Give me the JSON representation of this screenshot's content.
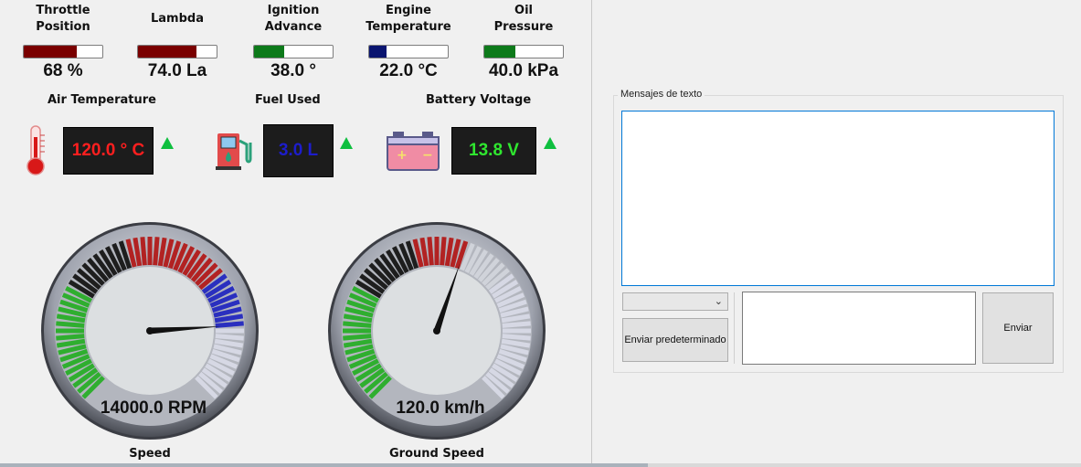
{
  "top_gauges": [
    {
      "label_line1": "Throttle",
      "label_line2": "Position",
      "value": "68 %",
      "fill": 0.68,
      "color": "#7a0000"
    },
    {
      "label_line1": "Lambda",
      "label_line2": "",
      "value": "74.0 La",
      "fill": 0.74,
      "color": "#7a0000"
    },
    {
      "label_line1": "Ignition",
      "label_line2": "Advance",
      "value": "38.0 °",
      "fill": 0.38,
      "color": "#0d7a1a"
    },
    {
      "label_line1": "Engine",
      "label_line2": "Temperature",
      "value": "22.0 °C",
      "fill": 0.22,
      "color": "#0a1570"
    },
    {
      "label_line1": "Oil",
      "label_line2": "Pressure",
      "value": "40.0 kPa",
      "fill": 0.4,
      "color": "#0d7a1a"
    }
  ],
  "displays": [
    {
      "label": "Air Temperature",
      "value": "120.0 ° C",
      "color": "#ff1f1f",
      "icon": "thermometer-icon",
      "trend": "up"
    },
    {
      "label": "Fuel Used",
      "value": "3.0 L",
      "color": "#1d1dcc",
      "icon": "fuel-pump-icon",
      "trend": "up"
    },
    {
      "label": "Battery Voltage",
      "value": "13.8 V",
      "color": "#2fe62f",
      "icon": "battery-icon",
      "trend": "up"
    }
  ],
  "dials": [
    {
      "label": "Speed",
      "value_text": "14000.0 RPM",
      "fraction": 0.82
    },
    {
      "label": "Ground Speed",
      "value_text": "120.0 km/h",
      "fraction": 0.57
    }
  ],
  "messages": {
    "group_title": "Mensajes de texto",
    "log_text": "",
    "selected_option": "",
    "preset_button": "Enviar predeterminado",
    "input_text": "",
    "send_button": "Enviar"
  },
  "colors": {
    "trend_up": "#0fbf3f",
    "selection_border": "#0078d7"
  }
}
